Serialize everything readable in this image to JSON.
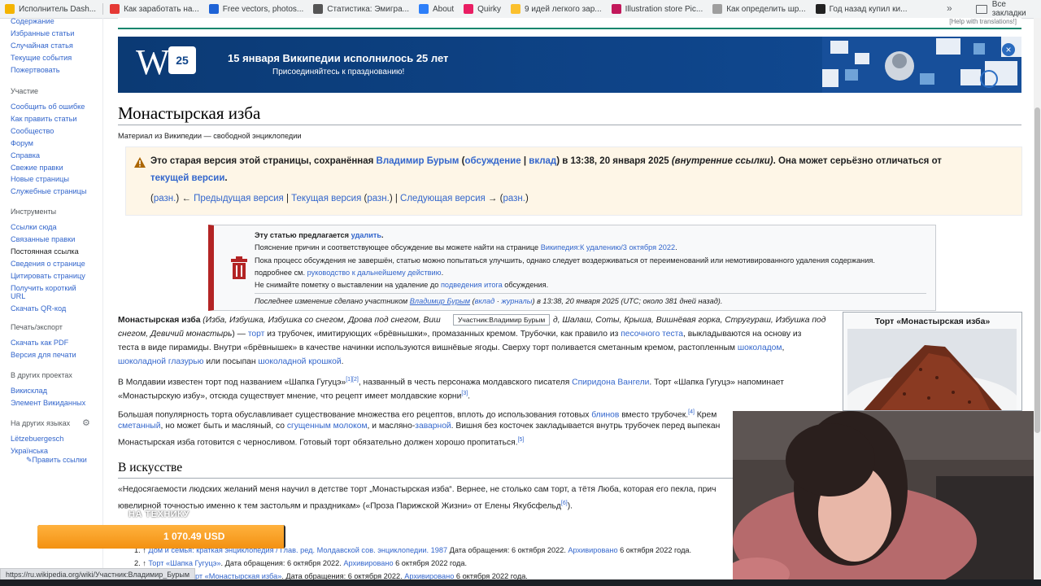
{
  "bookmarks": [
    {
      "label": "Исполнитель Dash...",
      "color": "#f4b400"
    },
    {
      "label": "Как заработать на...",
      "color": "#e53935"
    },
    {
      "label": "Free vectors, photos...",
      "color": "#1e63d6"
    },
    {
      "label": "Статистика: Эмигра...",
      "color": "#555555"
    },
    {
      "label": "About",
      "color": "#2d7ff9"
    },
    {
      "label": "Quirky",
      "color": "#e91e63"
    },
    {
      "label": "9 идей легкого зар...",
      "color": "#fbc02d"
    },
    {
      "label": "Illustration store Pic...",
      "color": "#c2185b"
    },
    {
      "label": "Как определить шр...",
      "color": "#9e9e9e"
    },
    {
      "label": "Год назад купил ки...",
      "color": "#222222"
    }
  ],
  "bookmarks_more": "»",
  "bookmarks_all": "Все закладки",
  "sidebar": {
    "nav": [
      "Содержание",
      "Избранные статьи",
      "Случайная статья",
      "Текущие события",
      "Пожертвовать"
    ],
    "participation_head": "Участие",
    "participation": [
      "Сообщить об ошибке",
      "Как править статьи",
      "Сообщество",
      "Форум",
      "Справка",
      "Свежие правки",
      "Новые страницы",
      "Служебные страницы"
    ],
    "tools_head": "Инструменты",
    "tools": [
      "Ссылки сюда",
      "Связанные правки",
      "Постоянная ссылка",
      "Сведения о странице",
      "Цитировать страницу",
      "Получить короткий",
      "URL",
      "Скачать QR-код"
    ],
    "print_head": "Печать/экспорт",
    "print": [
      "Скачать как PDF",
      "Версия для печати"
    ],
    "projects_head": "В других проектах",
    "projects": [
      "Викисклад",
      "Элемент Викиданных"
    ],
    "langs_head": "На других языках",
    "langs": [
      "Lëtzebuergesch",
      "Українська"
    ],
    "edit_links": "✎Править ссылки"
  },
  "top_strip": {
    "help": "[Help with translations!]"
  },
  "banner": {
    "logo": "W",
    "badge": "25",
    "title": "15 января Википедии исполнилось 25 лет",
    "subtitle": "Присоединяйтесь к празднованию!",
    "close": "×"
  },
  "article": {
    "title": "Монастырская изба",
    "site_sub": "Материал из Википедии — свободной энциклопедии"
  },
  "old_version": {
    "l1_a": "Это старая версия этой страницы, сохранённая ",
    "l1_user": "Владимир Бурым",
    "l1_b": " (",
    "l1_talk": "обсуждение",
    "l1_sep": " | ",
    "l1_contrib": "вклад",
    "l1_c": ") в 13:38, 20 января 2025 ",
    "l1_italic": "(внутренние ссылки)",
    "l1_d": ". Она может серьёзно отличаться от",
    "l2_link": "текущей версии",
    "l2_end": ".",
    "nav_a": "(",
    "nav_diff1": "разн.",
    "nav_b": ") ← ",
    "nav_prev": "Предыдущая версия",
    "nav_c": " | ",
    "nav_curr": "Текущая версия",
    "nav_d": " (",
    "nav_diff2": "разн.",
    "nav_e": ") | ",
    "nav_next": "Следующая версия",
    "nav_f": " → (",
    "nav_diff3": "разн.",
    "nav_g": ")"
  },
  "deletion": {
    "l1_a": "Эту статью предлагается ",
    "l1_link": "удалить",
    "l1_b": ".",
    "l2_a": "Пояснение причин и соответствующее обсуждение вы можете найти на странице ",
    "l2_link": "Википедия:К удалению/3 октября 2022",
    "l2_b": ".",
    "l3": "Пока процесс обсуждения не завершён, статью можно попытаться улучшить, однако следует воздерживаться от переименований или немотивированного удаления содержания.",
    "l4_a": "подробнее см. ",
    "l4_link": "руководство к дальнейшему действию",
    "l4_b": ".",
    "l5_a": "Не снимайте пометку о выставлении на удаление до ",
    "l5_link": "подведения итога",
    "l5_b": " обсуждения.",
    "l6_a": "Последнее изменение сделано участником ",
    "l6_user": "Владимир Бурым",
    "l6_b": " (",
    "l6_contrib": "вклад",
    "l6_c": " · ",
    "l6_logs": "журналы",
    "l6_d": ") в 13:38, 20 января 2025 (UTC; около 381 дней назад)."
  },
  "tooltip": "Участник:Владимир Бурым",
  "body": {
    "p1_l1_bold": "Монастырская изба",
    "p1_l1_it": " (Изба, Избушка, Избушка со снегом, Дрова под снегом, Виш",
    "p1_l1_tail": "д, Шалаш, Соты, Крыша, Вишнёвая горка, Стругураш, Избушка под",
    "p1_l2_it": "снегом, Девичий монастырь",
    "p1_l2_a": ") — ",
    "p1_l2_tort": "торт",
    "p1_l2_b": " из трубочек, имитирующих «брёвнышки», промазанных кремом. Трубочки, как правило из ",
    "p1_l2_dough": "песочного теста",
    "p1_l2_c": ", выкладываются на основу из",
    "p1_l3_a": "теста в виде пирамиды. Внутри «брёвнышек» в качестве начинки используются вишнёвые ягоды. Сверху торт поливается сметанным кремом, растопленным ",
    "p1_l3_choc": "шоколадом",
    "p1_l3_b": ",",
    "p1_l4_glaze": "шоколадной глазурью",
    "p1_l4_a": " или посыпан ",
    "p1_l4_crumb": "шоколадной крошкой",
    "p1_l4_b": ".",
    "p2_l1_a": "В Молдавии известен торт под названием «Шапка Гугуцэ»",
    "p2_l1_r1": "[1]",
    "p2_l1_r2": "[2]",
    "p2_l1_b": ", названный в честь персонажа молдавского писателя ",
    "p2_l1_spir": "Спиридона Вангели",
    "p2_l1_c": ". Торт «Шапка Гугуцэ» напоминает",
    "p2_l2_a": "«Монастырскую избу», отсюда существует мнение, что рецепт имеет молдавские корни",
    "p2_l2_r3": "[3]",
    "p2_l2_b": ".",
    "p3_l1_a": "Большая популярность торта обуславливает существование множества его рецептов, вплоть до использования готовых ",
    "p3_l1_blin": "блинов",
    "p3_l1_b": " вместо трубочек.",
    "p3_l1_r4": "[4]",
    "p3_l1_c": " Крем",
    "p3_l2_smet": "сметанный",
    "p3_l2_a": ", но может быть и масляный, со ",
    "p3_l2_milk": "сгущенным молоком",
    "p3_l2_b": ", и масляно-",
    "p3_l2_zav": "заварной",
    "p3_l2_c": ". Вишня без косточек закладывается внутрь трубочек перед выпекан",
    "p3_l3_a": "Монастырская изба готовится с черносливом. Готовый торт обязательно должен хорошо пропитаться.",
    "p3_l3_r5": "[5]",
    "section_art": "В искусстве",
    "p4_l1": "«Недосягаемости людских желаний меня научил в детстве торт „Монастырская изба“. Вернее, не столько сам торт, а тётя Люба, которая его пекла, прич",
    "p4_l2_a": "ювелирной точностью именно к тем застольям и праздникам» («Проза Парижской Жизни» от Елены Якубсфельд",
    "p4_l2_r6": "[6]",
    "p4_l2_b": ")."
  },
  "infobox": {
    "title": "Торт «Монастырская изба»"
  },
  "references": [
    {
      "lead": "1. ↑ ",
      "link": "Дом и семья: краткая энциклопедия / Глав. ред. Молдавской сов. энциклопедии. 1987",
      "rest": " Дата обращения: 6 октября 2022. ",
      "arch": "Архивировано",
      "date": " 6 октября 2022 года."
    },
    {
      "lead": "2. ↑ ",
      "link": "Торт «Шапка Гугуцэ»",
      "rest": ". Дата обращения: 6 октября 2022. ",
      "arch": "Архивировано",
      "date": " 6 октября 2022 года."
    },
    {
      "lead": "",
      "link": "Торт «Монастырская изба»",
      "rest": ". Дата обращения: 6 октября 2022. ",
      "arch": "Архивировано",
      "date": " 6 октября 2022 года."
    }
  ],
  "overlay": {
    "ticker_label": "НА ТЕХНИКУ",
    "ticker_value": "1 070.49 USD",
    "ticker_fill_fraction": 0.995,
    "status_url": "https://ru.wikipedia.org/wiki/Участник:Владимир_Бурым"
  }
}
